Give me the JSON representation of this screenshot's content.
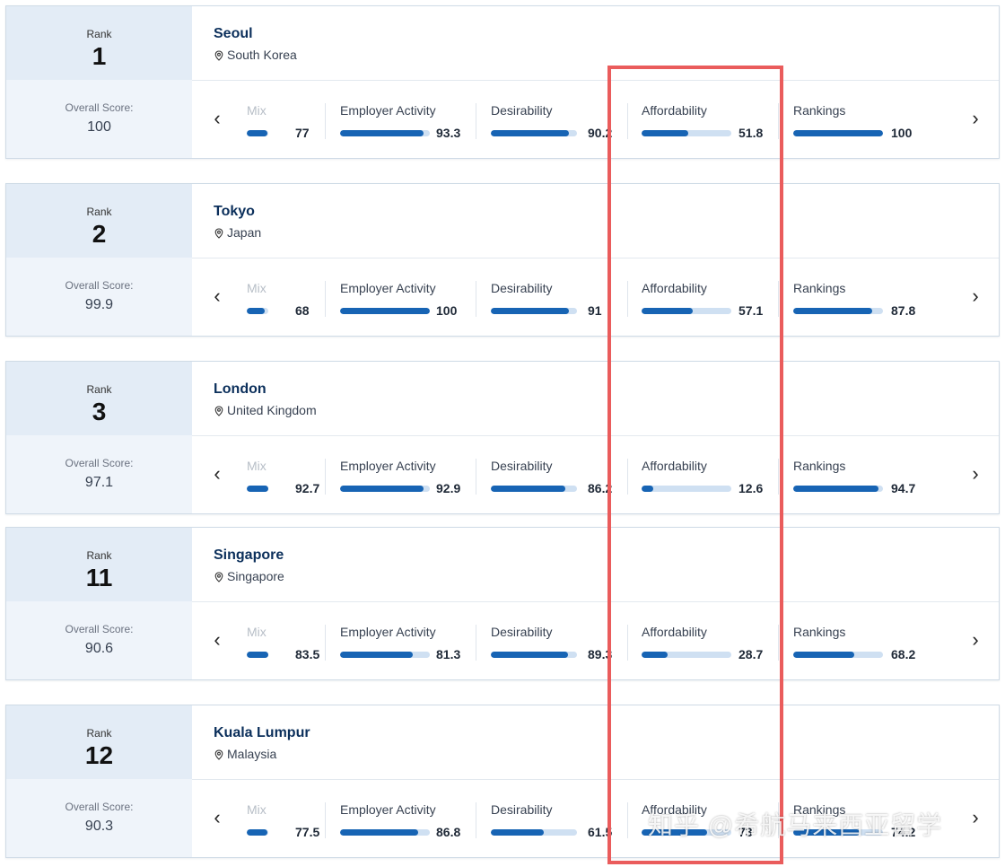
{
  "labels": {
    "rank": "Rank",
    "overall_score": "Overall Score:"
  },
  "metric_names": [
    "Mix",
    "Employer Activity",
    "Desirability",
    "Affordability",
    "Rankings"
  ],
  "cities": [
    {
      "rank": "1",
      "city": "Seoul",
      "country": "South Korea",
      "overall": "100",
      "metrics": [
        {
          "value": "77",
          "level": 0.77
        },
        {
          "value": "93.3",
          "level": 0.933
        },
        {
          "value": "90.2",
          "level": 0.902
        },
        {
          "value": "51.8",
          "level": 0.518
        },
        {
          "value": "100",
          "level": 1.0
        }
      ]
    },
    {
      "rank": "2",
      "city": "Tokyo",
      "country": "Japan",
      "overall": "99.9",
      "metrics": [
        {
          "value": "68",
          "level": 0.68
        },
        {
          "value": "100",
          "level": 1.0
        },
        {
          "value": "91",
          "level": 0.91
        },
        {
          "value": "57.1",
          "level": 0.571
        },
        {
          "value": "87.8",
          "level": 0.878
        }
      ]
    },
    {
      "rank": "3",
      "city": "London",
      "country": "United Kingdom",
      "overall": "97.1",
      "metrics": [
        {
          "value": "92.7",
          "level": 0.927
        },
        {
          "value": "92.9",
          "level": 0.929
        },
        {
          "value": "86.2",
          "level": 0.862
        },
        {
          "value": "12.6",
          "level": 0.126
        },
        {
          "value": "94.7",
          "level": 0.947
        }
      ]
    },
    {
      "rank": "11",
      "city": "Singapore",
      "country": "Singapore",
      "overall": "90.6",
      "metrics": [
        {
          "value": "83.5",
          "level": 0.835
        },
        {
          "value": "81.3",
          "level": 0.813
        },
        {
          "value": "89.3",
          "level": 0.893
        },
        {
          "value": "28.7",
          "level": 0.287
        },
        {
          "value": "68.2",
          "level": 0.682
        }
      ]
    },
    {
      "rank": "12",
      "city": "Kuala Lumpur",
      "country": "Malaysia",
      "overall": "90.3",
      "metrics": [
        {
          "value": "77.5",
          "level": 0.775
        },
        {
          "value": "86.8",
          "level": 0.868
        },
        {
          "value": "61.5",
          "level": 0.615
        },
        {
          "value": "73",
          "level": 0.73
        },
        {
          "value": "74.2",
          "level": 0.742
        }
      ]
    }
  ],
  "watermark": "知乎 @希航马来西亚留学",
  "colors": {
    "bar_fill": "#1764b4",
    "bar_track": "#cfe0f2",
    "highlight_box": "#ea5c5c",
    "city_name": "#0b2f5b"
  },
  "icons": {
    "location": "map-pin-icon",
    "prev": "chevron-left-icon",
    "next": "chevron-right-icon"
  }
}
